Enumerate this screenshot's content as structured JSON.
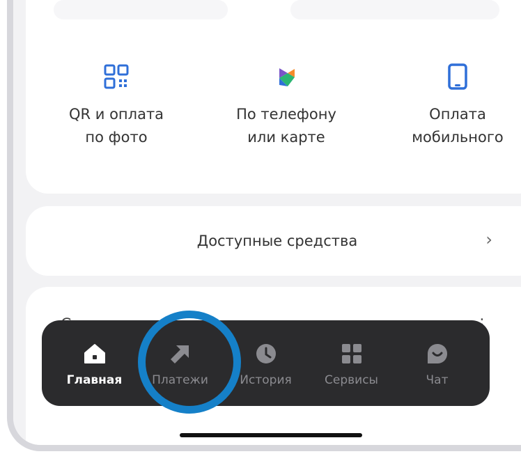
{
  "quick_actions": [
    {
      "icon": "qr-code-icon",
      "label": "QR и оплата\nпо фото"
    },
    {
      "icon": "sbp-icon",
      "label": "По телефону\nили карте"
    },
    {
      "icon": "mobile-phone-icon",
      "label": "Оплата\nмобильного"
    }
  ],
  "available_funds": {
    "label": "Доступные средства",
    "chevron": "›"
  },
  "next_card": {
    "peek_text": "С",
    "menu": "⋮"
  },
  "tabbar": {
    "active": "Главная",
    "tabs": [
      {
        "label": "Главная",
        "icon": "home-icon"
      },
      {
        "label": "Платежи",
        "icon": "arrow-up-right-icon"
      },
      {
        "label": "История",
        "icon": "clock-icon"
      },
      {
        "label": "Сервисы",
        "icon": "grid-icon"
      },
      {
        "label": "Чат",
        "icon": "chat-icon"
      }
    ]
  },
  "colors": {
    "accent_ring": "#1580c8",
    "icon_blue": "#2f6fd8",
    "tabbar_bg": "#2b2b2d",
    "sbp_green": "#2bb673",
    "sbp_orange": "#f58b2b",
    "sbp_purple": "#7a55c8"
  }
}
